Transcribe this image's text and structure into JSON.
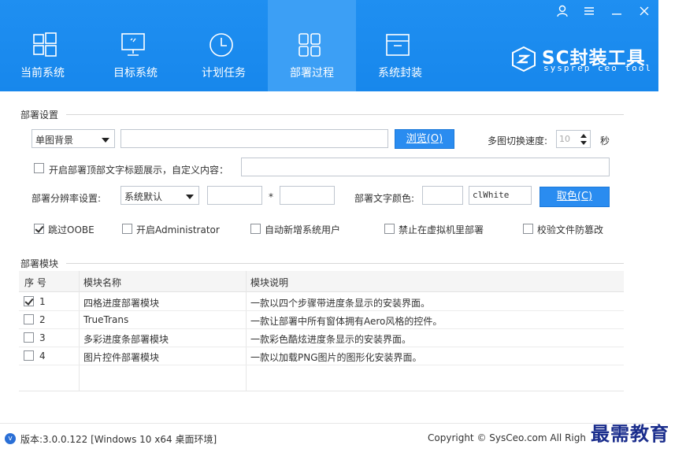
{
  "window_controls": {
    "user_icon": "user-icon",
    "menu_icon": "menu-icon",
    "minimize_icon": "minimize-icon",
    "close_icon": "close-icon"
  },
  "colors": {
    "header_bg": "#1f8ff1",
    "active_tab": "#3c9ff5",
    "button": "#2a8cf0",
    "watermark": "#1a2d8c"
  },
  "nav": [
    {
      "label": "当前系统",
      "icon": "windows-icon"
    },
    {
      "label": "目标系统",
      "icon": "monitor-icon"
    },
    {
      "label": "计划任务",
      "icon": "clock-icon"
    },
    {
      "label": "部署过程",
      "icon": "grid-icon",
      "active": true
    },
    {
      "label": "系统封装",
      "icon": "box-icon"
    }
  ],
  "brand": {
    "title": "SC封装工具",
    "subtitle": "sysprep ceo tool"
  },
  "deploy_settings": {
    "section_title": "部署设置",
    "background_mode": "单图背景",
    "image_path": "",
    "browse_button": "浏览(O)",
    "switch_speed_label": "多图切换速度:",
    "switch_speed_value": "10",
    "seconds_unit": "秒",
    "title_checkbox_label": "开启部署顶部文字标题展示，自定义内容：",
    "title_text": "",
    "resolution_label": "部署分辨率设置:",
    "resolution_mode": "系统默认",
    "resolution_width": "",
    "resolution_times": "*",
    "resolution_height": "",
    "text_color_label": "部署文字颜色:",
    "text_color_swatch": "",
    "text_color_value": "clWhite",
    "pick_color_button": "取色(C)",
    "options": [
      {
        "label": "跳过OOBE",
        "checked": true
      },
      {
        "label": "开启Administrator",
        "checked": false
      },
      {
        "label": "自动新增系统用户",
        "checked": false
      },
      {
        "label": "禁止在虚拟机里部署",
        "checked": false
      },
      {
        "label": "校验文件防篡改",
        "checked": false
      }
    ]
  },
  "modules": {
    "section_title": "部署模块",
    "columns": [
      "序 号",
      "模块名称",
      "模块说明"
    ],
    "rows": [
      {
        "index": "1",
        "checked": true,
        "name": "四格进度部署模块",
        "desc": "一款以四个步骤带进度条显示的安装界面。"
      },
      {
        "index": "2",
        "checked": false,
        "name": "TrueTrans",
        "desc": "一款让部署中所有窗体拥有Aero风格的控件。"
      },
      {
        "index": "3",
        "checked": false,
        "name": "多彩进度条部署模块",
        "desc": "一款彩色酷炫进度条显示的安装界面。"
      },
      {
        "index": "4",
        "checked": false,
        "name": "图片控件部署模块",
        "desc": "一款以加载PNG图片的图形化安装界面。"
      }
    ]
  },
  "footer": {
    "version_icon": "v-icon",
    "version": "版本:3.0.0.122 [Windows 10 x64 桌面环境]",
    "copyright": "Copyright © SysCeo.com All Righ",
    "watermark": "最需教育"
  }
}
